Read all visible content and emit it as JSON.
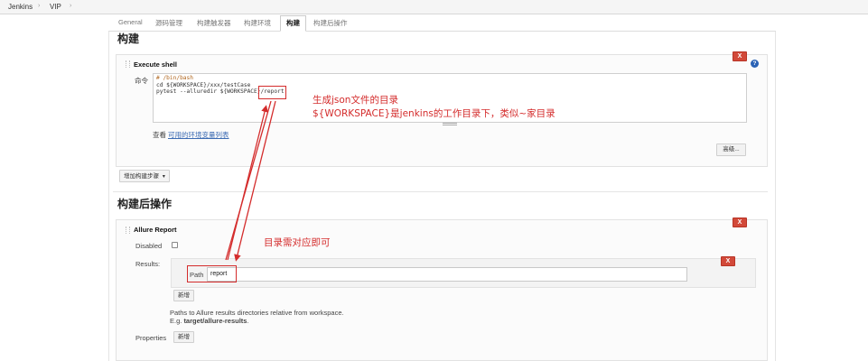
{
  "breadcrumb": {
    "root": "Jenkins",
    "separator": "›",
    "job": "VIP"
  },
  "tabs": [
    "General",
    "源码管理",
    "构建触发器",
    "构建环境",
    "构建",
    "构建后操作"
  ],
  "build": {
    "section_title": "构建",
    "step_title": "Execute shell",
    "command_label": "命令",
    "script_lines": [
      "# /bin/bash",
      "cd ${WORKSPACE}/xxx/testCase",
      "pytest --alluredir ${WORKSPACE}/report"
    ],
    "env_prefix": "查看",
    "env_link": "可用的环境变量列表",
    "advanced_button": "高级...",
    "add_step_button": "增加构建步骤",
    "delete_label": "X",
    "help_label": "?"
  },
  "post_build": {
    "section_title": "构建后操作",
    "step_title": "Allure Report",
    "disabled_label": "Disabled",
    "results_label": "Results:",
    "path_label": "Path",
    "path_value": "report",
    "add_button": "新增",
    "hint_line1": "Paths to Allure results directories relative from workspace.",
    "hint_line2_prefix": "E.g.",
    "hint_line2_value": "target/allure-results",
    "hint_line2_suffix": ".",
    "properties_label": "Properties",
    "properties_add_button": "新增",
    "delete_label": "X"
  },
  "annotations": {
    "note1_line1": "生成json文件的目录",
    "note1_line2": "${WORKSPACE}是jenkins的工作目录下，类似~家目录",
    "note2": "目录需对应即可"
  },
  "colors": {
    "annotation_red": "#d42c2c",
    "delete_button": "#d24939",
    "help_blue": "#2a62b5",
    "link_blue": "#3c6bb3"
  }
}
